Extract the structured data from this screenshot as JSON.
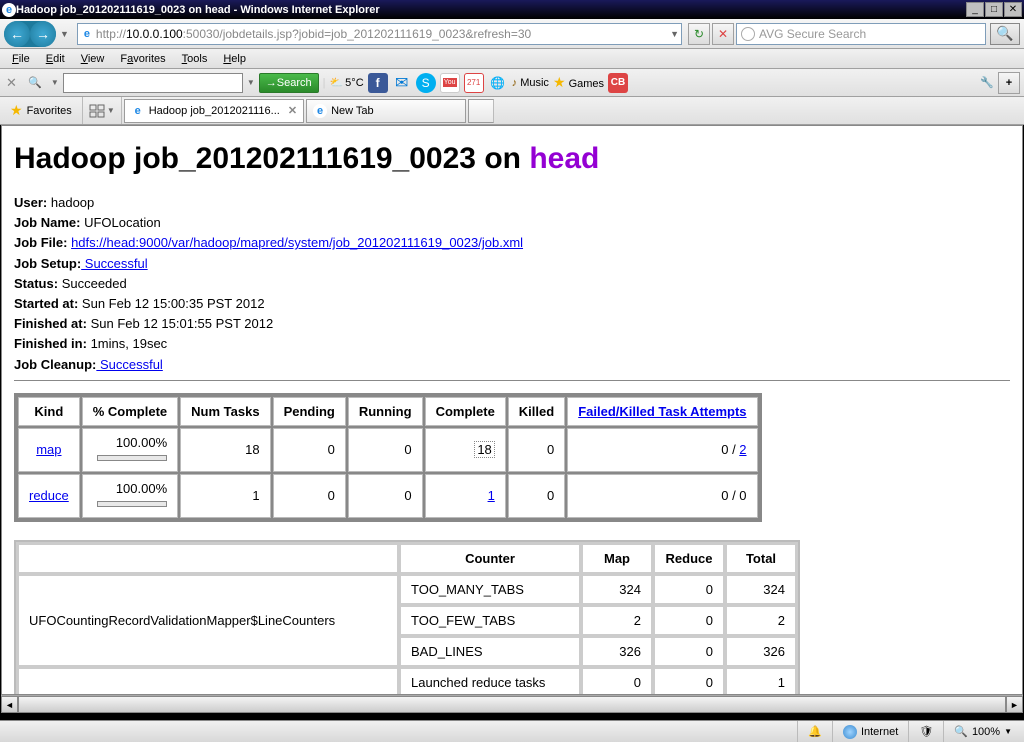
{
  "titlebar": {
    "text": "Hadoop job_201202111619_0023 on head - Windows Internet Explorer"
  },
  "nav": {
    "url_prefix": "http://",
    "url_host": "10.0.0.100",
    "url_rest": ":50030/jobdetails.jsp?jobid=job_201202111619_0023&refresh=30",
    "search_placeholder": "AVG Secure Search"
  },
  "menu": {
    "file": "File",
    "edit": "Edit",
    "view": "View",
    "favorites": "Favorites",
    "tools": "Tools",
    "help": "Help"
  },
  "tb2": {
    "search": "Search",
    "temp": "5°C",
    "music": "Music",
    "games": "Games",
    "cal": "271"
  },
  "favbar": {
    "favorites": "Favorites",
    "tab1": "Hadoop job_2012021116...",
    "tab2": "New Tab"
  },
  "page": {
    "h1_a": "Hadoop job_201202111619_0023 on ",
    "h1_b": "head",
    "user_l": "User:",
    "user_v": "hadoop",
    "jobname_l": "Job Name:",
    "jobname_v": "UFOLocation",
    "jobfile_l": "Job File:",
    "jobfile_v": "hdfs://head:9000/var/hadoop/mapred/system/job_201202111619_0023/job.xml",
    "setup_l": "Job Setup:",
    "setup_v": " Successful",
    "status_l": "Status:",
    "status_v": "Succeeded",
    "started_l": "Started at:",
    "started_v": "Sun Feb 12 15:00:35 PST 2012",
    "finished_l": "Finished at:",
    "finished_v": "Sun Feb 12 15:01:55 PST 2012",
    "finishedin_l": "Finished in:",
    "finishedin_v": "1mins, 19sec",
    "cleanup_l": "Job Cleanup:",
    "cleanup_v": " Successful"
  },
  "tasktable": {
    "h_kind": "Kind",
    "h_pct": "% Complete",
    "h_num": "Num Tasks",
    "h_pending": "Pending",
    "h_running": "Running",
    "h_complete": "Complete",
    "h_killed": "Killed",
    "h_fk": "Failed/Killed Task Attempts",
    "rows": [
      {
        "kind": "map",
        "pct": "100.00%",
        "num": "18",
        "pending": "0",
        "running": "0",
        "complete": "18",
        "killed": "0",
        "failed": "0",
        "killed2": "2"
      },
      {
        "kind": "reduce",
        "pct": "100.00%",
        "num": "1",
        "pending": "0",
        "running": "0",
        "complete": "1",
        "killed": "0",
        "failed": "0",
        "killed2": "0"
      }
    ]
  },
  "countertable": {
    "h_counter": "Counter",
    "h_map": "Map",
    "h_reduce": "Reduce",
    "h_total": "Total",
    "group": "UFOCountingRecordValidationMapper$LineCounters",
    "rows": [
      {
        "name": "TOO_MANY_TABS",
        "map": "324",
        "reduce": "0",
        "total": "324"
      },
      {
        "name": "TOO_FEW_TABS",
        "map": "2",
        "reduce": "0",
        "total": "2"
      },
      {
        "name": "BAD_LINES",
        "map": "326",
        "reduce": "0",
        "total": "326"
      },
      {
        "name": "Launched reduce tasks",
        "map": "0",
        "reduce": "0",
        "total": "1"
      }
    ]
  },
  "status": {
    "internet": "Internet",
    "zoom": "100%"
  }
}
